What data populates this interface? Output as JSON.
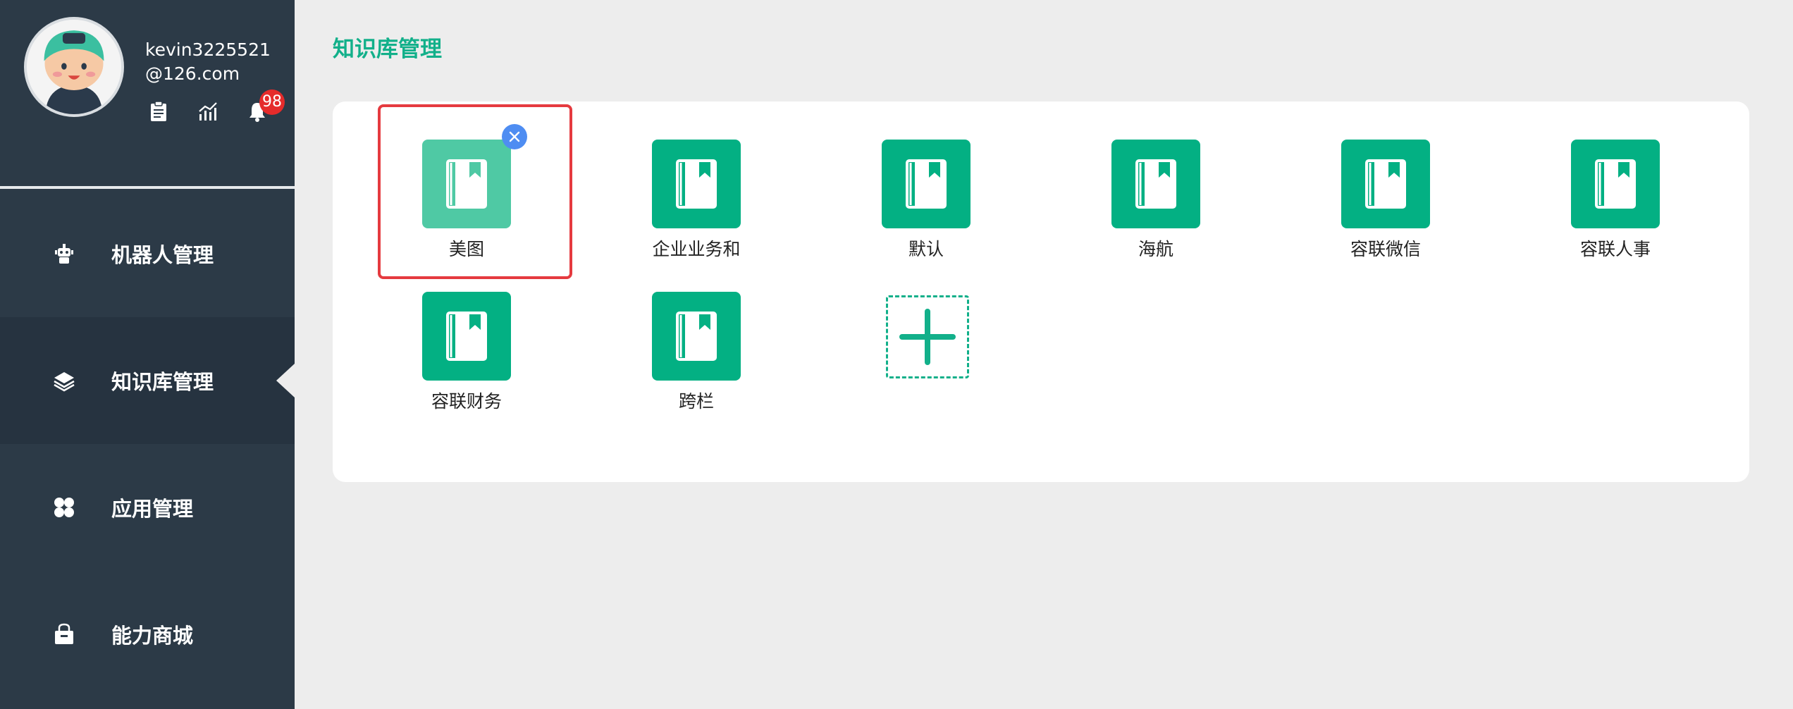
{
  "profile": {
    "username": "kevin3225521@126.com",
    "notification_count": "98",
    "icons": [
      "clipboard-icon",
      "chart-icon",
      "bell-icon"
    ]
  },
  "sidebar": {
    "items": [
      {
        "label": "机器人管理",
        "icon": "robot-icon",
        "active": false
      },
      {
        "label": "知识库管理",
        "icon": "layers-icon",
        "active": true
      },
      {
        "label": "应用管理",
        "icon": "apps-icon",
        "active": false
      },
      {
        "label": "能力商城",
        "icon": "shop-icon",
        "active": false
      }
    ]
  },
  "main": {
    "title": "知识库管理",
    "knowledge_bases": [
      {
        "label": "美图",
        "selected": true
      },
      {
        "label": "企业业务和",
        "selected": false
      },
      {
        "label": "默认",
        "selected": false
      },
      {
        "label": "海航",
        "selected": false
      },
      {
        "label": "容联微信",
        "selected": false
      },
      {
        "label": "容联人事",
        "selected": false
      },
      {
        "label": "容联财务",
        "selected": false
      },
      {
        "label": "跨栏",
        "selected": false
      }
    ],
    "add_icon": "plus-icon",
    "delete_icon": "close-icon"
  },
  "colors": {
    "sidebar_bg": "#2c3a47",
    "accent": "#03b083",
    "title": "#12b08a",
    "selection": "#e53a3f",
    "delete": "#4e8df2",
    "badge": "#e52b2b"
  }
}
